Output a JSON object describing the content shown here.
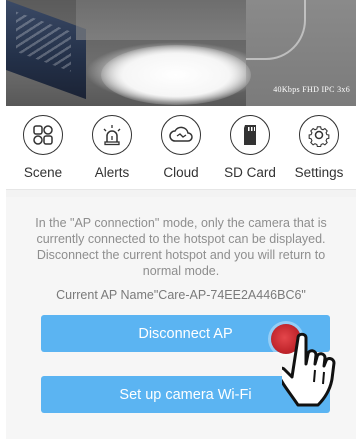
{
  "feed": {
    "stats": "40Kbps FHD IPC 3x6"
  },
  "toolbar": {
    "items": [
      {
        "label": "Scene",
        "icon": "scene-icon"
      },
      {
        "label": "Alerts",
        "icon": "alarm-icon"
      },
      {
        "label": "Cloud",
        "icon": "cloud-icon"
      },
      {
        "label": "SD Card",
        "icon": "sd-card-icon"
      },
      {
        "label": "Settings",
        "icon": "gear-icon"
      }
    ]
  },
  "ap_panel": {
    "info": "In the \"AP connection\" mode, only the camera that is currently connected to the hotspot can be displayed. Disconnect the current hotspot and you will return to normal mode.",
    "ap_name": "Current AP Name\"Care-AP-74EE2A446BC6\"",
    "disconnect_label": "Disconnect AP",
    "setup_label": "Set up camera Wi-Fi"
  },
  "colors": {
    "button": "#5bb4f2",
    "button_text": "#ffffff",
    "panel_bg": "#f6f6f6",
    "tap_marker": "#c1262c"
  }
}
